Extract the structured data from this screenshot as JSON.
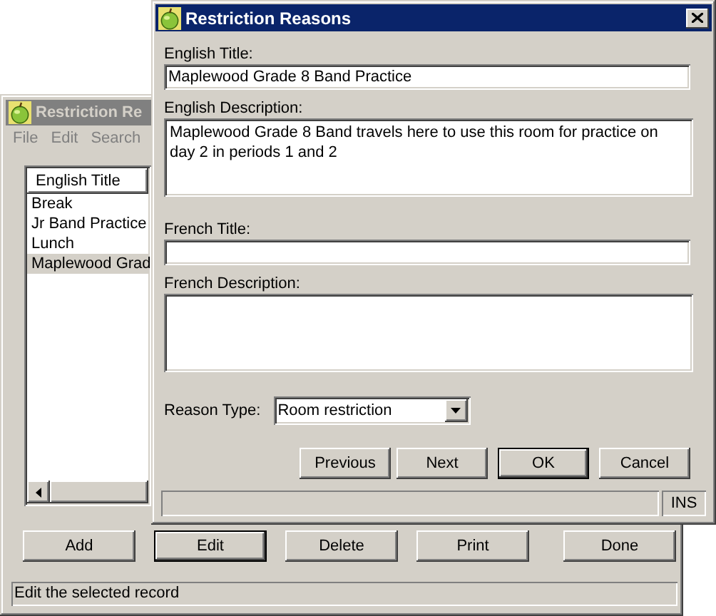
{
  "back_window": {
    "title": "Restriction Re",
    "active": false,
    "menu": [
      "File",
      "Edit",
      "Search"
    ],
    "list": {
      "column": "English Title",
      "rows": [
        {
          "text": "Break",
          "selected": false
        },
        {
          "text": "Jr Band Practice",
          "selected": false
        },
        {
          "text": "Lunch",
          "selected": false
        },
        {
          "text": "Maplewood Grad",
          "selected": true
        }
      ]
    },
    "buttons": [
      {
        "label": "Add",
        "default": false
      },
      {
        "label": "Edit",
        "default": true
      },
      {
        "label": "Delete",
        "default": false
      },
      {
        "label": "Print",
        "default": false
      },
      {
        "label": "Done",
        "default": false
      }
    ],
    "status": "Edit the selected record"
  },
  "front_window": {
    "title": "Restriction Reasons",
    "active": true,
    "fields": [
      {
        "kind": "text",
        "label": "English Title:",
        "value": "Maplewood Grade 8 Band Practice"
      },
      {
        "kind": "textarea",
        "label": "English Description:",
        "value": "Maplewood Grade 8 Band travels here to use this room for practice on day 2 in periods 1 and 2"
      },
      {
        "kind": "text",
        "label": "French Title:"
      },
      {
        "kind": "textarea",
        "label": "French Description:"
      },
      {
        "kind": "select",
        "label": "Reason Type:",
        "value": "Room restriction"
      }
    ],
    "buttons": [
      {
        "label": "Previous",
        "default": false
      },
      {
        "label": "Next",
        "default": false
      },
      {
        "label": "OK",
        "default": true
      },
      {
        "label": "Cancel",
        "default": false
      }
    ],
    "status_panel": "INS"
  }
}
